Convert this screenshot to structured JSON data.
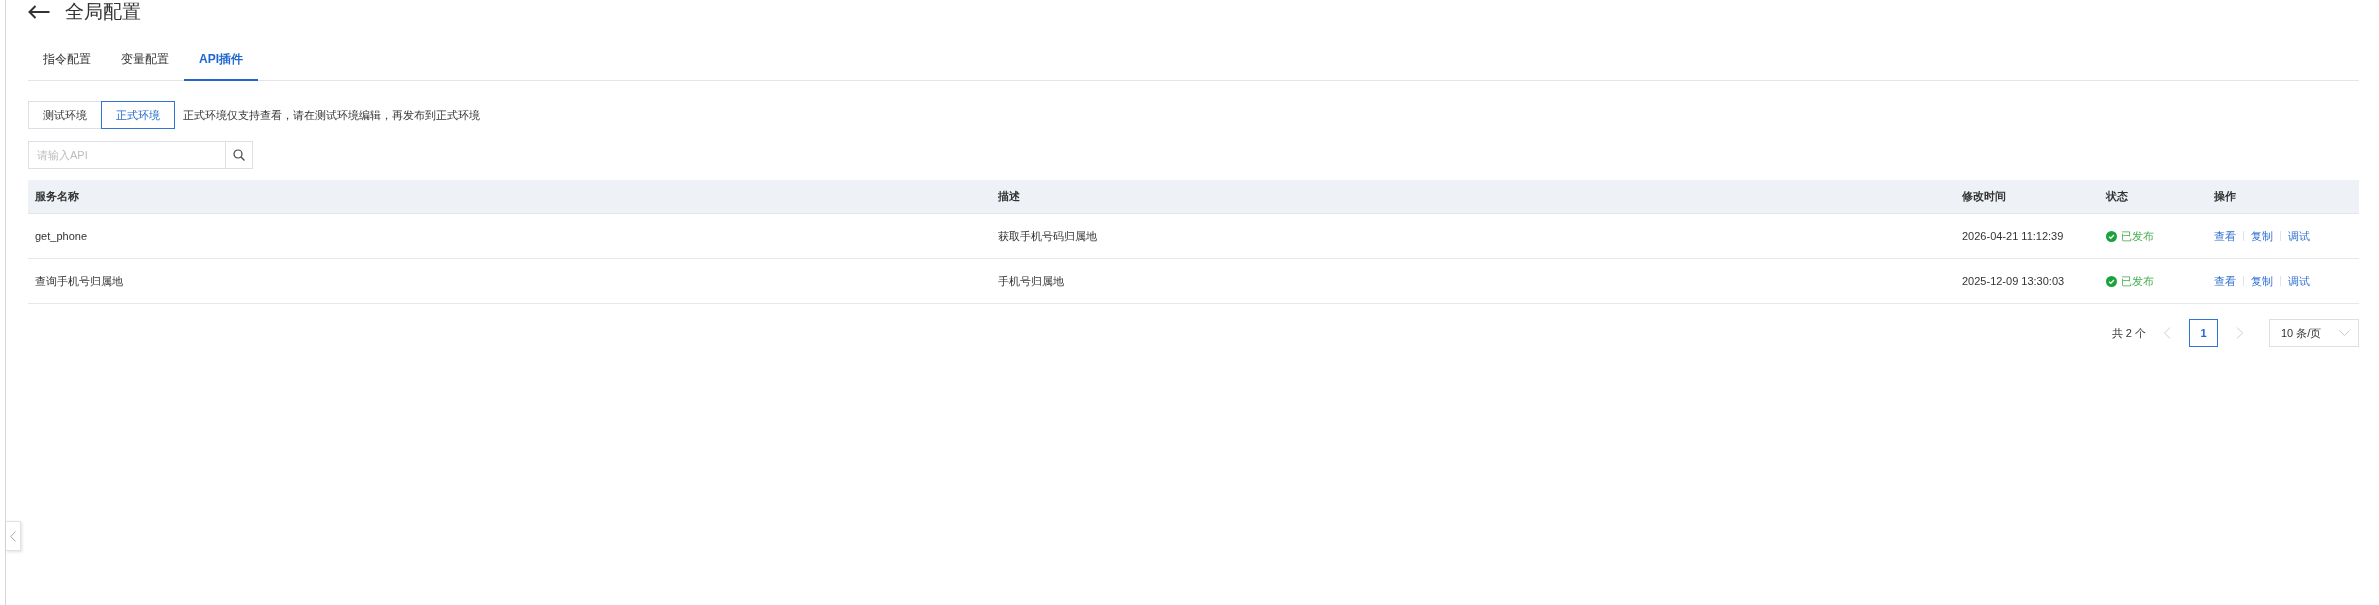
{
  "header": {
    "title": "全局配置"
  },
  "tabs": [
    {
      "label": "指令配置",
      "selected": false
    },
    {
      "label": "变量配置",
      "selected": false
    },
    {
      "label": "API插件",
      "selected": true
    }
  ],
  "environments": [
    {
      "label": "测试环境",
      "selected": false
    },
    {
      "label": "正式环境",
      "selected": true
    }
  ],
  "environment_hint": "正式环境仅支持查看，请在测试环境编辑，再发布到正式环境",
  "search": {
    "placeholder": "请输入API"
  },
  "table": {
    "columns": [
      "服务名称",
      "描述",
      "修改时间",
      "状态",
      "操作"
    ],
    "rows": [
      {
        "name": "get_phone",
        "description": "获取手机号码归属地",
        "modified_time": "2026-04-21 11:12:39",
        "status": {
          "kind": "published",
          "label": "已发布"
        },
        "actions": [
          "查看",
          "复制",
          "调试"
        ]
      },
      {
        "name": "查询手机号归属地",
        "description": "手机号归属地",
        "modified_time": "2025-12-09 13:30:03",
        "status": {
          "kind": "published",
          "label": "已发布"
        },
        "actions": [
          "查看",
          "复制",
          "调试"
        ]
      }
    ]
  },
  "pagination": {
    "total": "共 2 个",
    "previous": {
      "disabled": true
    },
    "pages": [
      {
        "label": "1",
        "selected": true
      }
    ],
    "next": {
      "disabled": true
    },
    "page_size": "10 条/页"
  }
}
